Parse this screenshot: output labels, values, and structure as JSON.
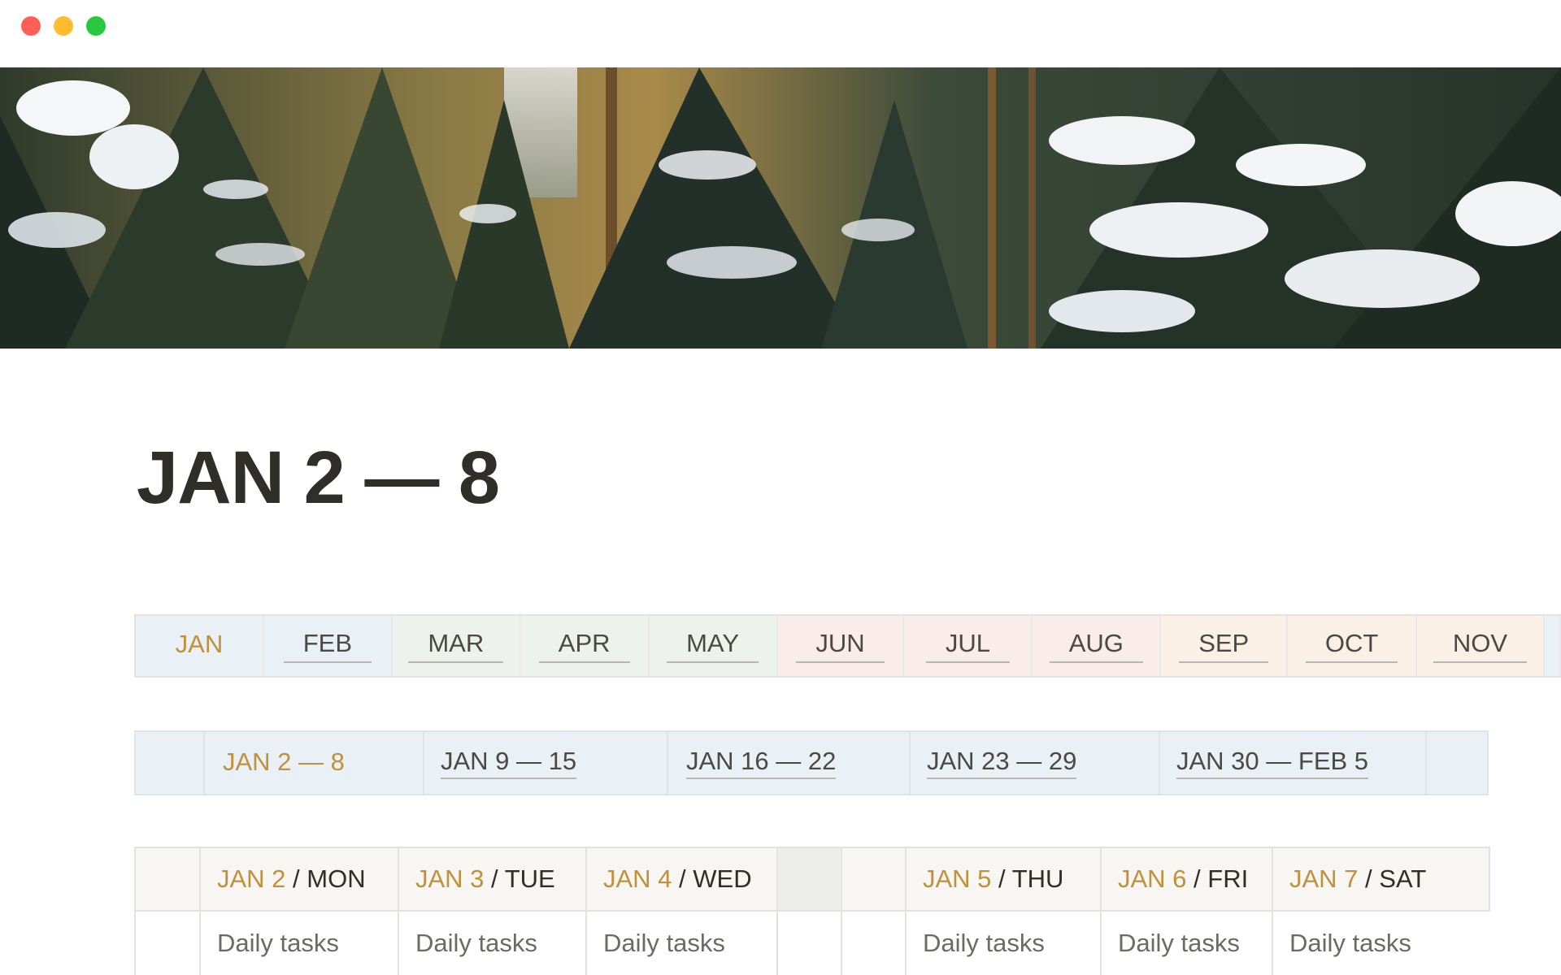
{
  "window": {
    "controls": [
      "close",
      "minimize",
      "zoom"
    ]
  },
  "cover": {
    "description_icon": "cover-image"
  },
  "page": {
    "title": "JAN 2 — 8"
  },
  "months": [
    {
      "label": "JAN",
      "bg": "#e9f0f6",
      "active": true
    },
    {
      "label": "FEB",
      "bg": "#e9f0f6",
      "active": false
    },
    {
      "label": "MAR",
      "bg": "#edf3ec",
      "active": false
    },
    {
      "label": "APR",
      "bg": "#edf3ec",
      "active": false
    },
    {
      "label": "MAY",
      "bg": "#edf3ec",
      "active": false
    },
    {
      "label": "JUN",
      "bg": "#fbecec",
      "active": false
    },
    {
      "label": "JUL",
      "bg": "#fbecec",
      "active": false
    },
    {
      "label": "AUG",
      "bg": "#fbecec",
      "active": false
    },
    {
      "label": "SEP",
      "bg": "#faf0e6",
      "active": false
    },
    {
      "label": "OCT",
      "bg": "#faf0e6",
      "active": false
    },
    {
      "label": "NOV",
      "bg": "#faf0e6",
      "active": false
    }
  ],
  "weeks": [
    {
      "label": "JAN 2 — 8",
      "active": true
    },
    {
      "label": "JAN 9 — 15",
      "active": false
    },
    {
      "label": "JAN 16 — 22",
      "active": false
    },
    {
      "label": "JAN 23 — 29",
      "active": false
    },
    {
      "label": "JAN 30 — FEB 5",
      "active": false
    }
  ],
  "days": [
    {
      "date": "JAN 2",
      "sep": " / ",
      "weekday": "MON",
      "task": "Daily tasks"
    },
    {
      "date": "JAN 3",
      "sep": " / ",
      "weekday": "TUE",
      "task": "Daily tasks"
    },
    {
      "date": "JAN 4",
      "sep": " / ",
      "weekday": "WED",
      "task": "Daily tasks"
    },
    {
      "date": "JAN 5",
      "sep": " / ",
      "weekday": "THU",
      "task": "Daily tasks"
    },
    {
      "date": "JAN 6",
      "sep": " / ",
      "weekday": "FRI",
      "task": "Daily tasks"
    },
    {
      "date": "JAN 7",
      "sep": " / ",
      "weekday": "SAT",
      "task": "Daily tasks"
    }
  ],
  "colors": {
    "accent": "#c0913a",
    "text": "#2f2e28",
    "blue_bg": "#e9f0f6",
    "green_bg": "#edf3ec",
    "red_bg": "#fbecec",
    "orange_bg": "#faf0e6"
  }
}
